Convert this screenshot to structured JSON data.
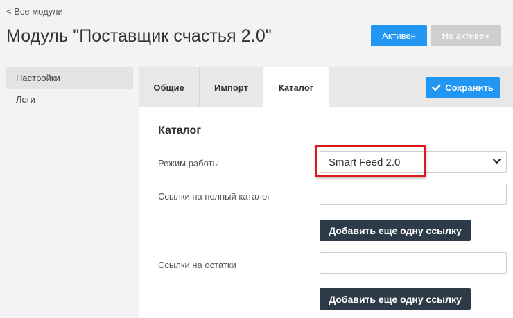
{
  "header": {
    "back_link": "< Все модули",
    "title": "Модуль \"Поставщик счастья 2.0\"",
    "active_label": "Активен",
    "inactive_label": "Не активен"
  },
  "sidebar": {
    "items": [
      {
        "label": "Настройки",
        "active": true
      },
      {
        "label": "Логи",
        "active": false
      }
    ]
  },
  "tabs": [
    {
      "label": "Общие"
    },
    {
      "label": "Импорт"
    },
    {
      "label": "Каталог",
      "selected": true
    }
  ],
  "toolbar": {
    "save_label": "Сохранить",
    "save_icon": "checkmark-icon"
  },
  "catalog": {
    "section_title": "Каталог",
    "mode_label": "Режим работы",
    "mode_value": "Smart Feed 2.0",
    "full_catalog_label": "Ссылки на полный каталог",
    "full_catalog_value": "",
    "add_link_label_1": "Добавить еще одну ссылку",
    "stock_label": "Ссылки на остатки",
    "stock_value": "",
    "add_link_label_2": "Добавить еще одну ссылку"
  },
  "colors": {
    "accent": "#2196f3",
    "dark_button": "#2d3a47",
    "highlight": "#e0191c",
    "inactive": "#cfcfcf"
  }
}
